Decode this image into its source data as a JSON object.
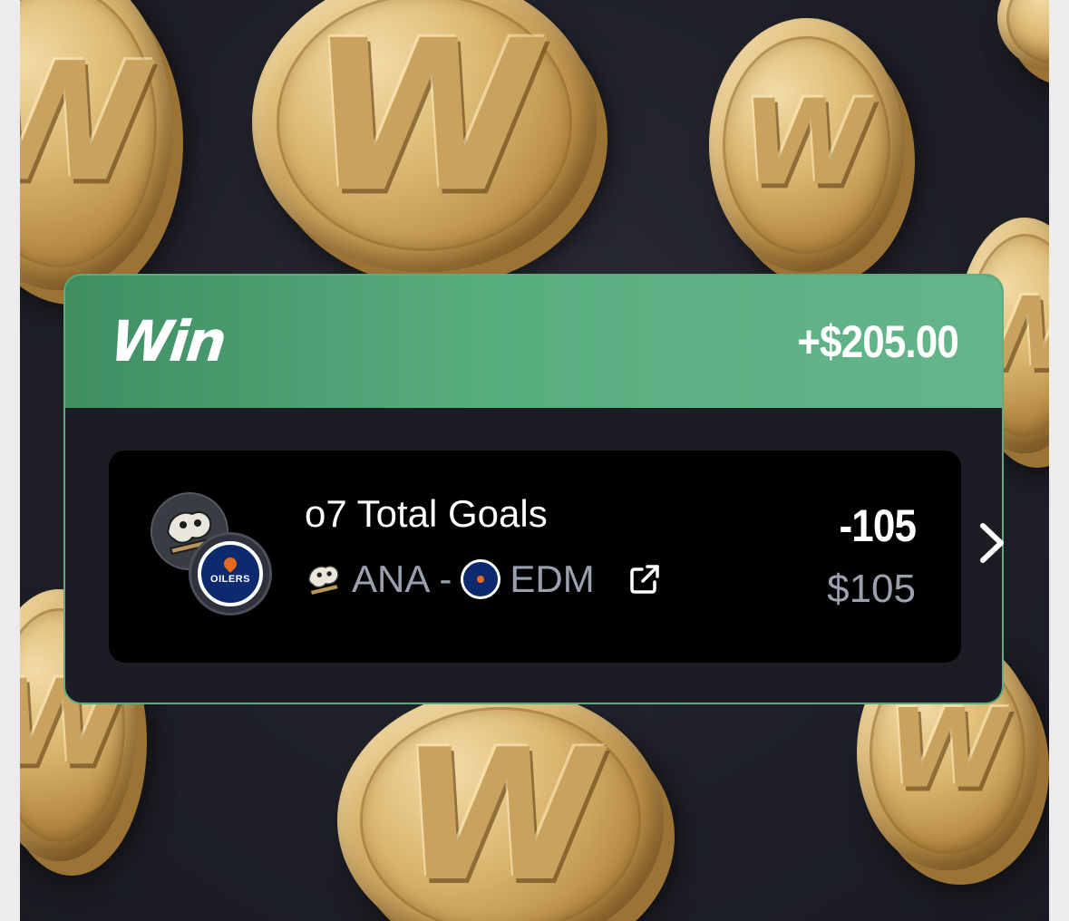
{
  "header": {
    "brand": "Win",
    "payout": "+$205.00"
  },
  "bet": {
    "title": "o7 Total Goals",
    "home_team": "ANA",
    "separator": "-",
    "away_team": "EDM",
    "odds": "-105",
    "stake": "$105"
  },
  "logos": {
    "primary_team": "ducks-logo",
    "secondary_team": "oilers-logo",
    "oilers_wordmark": "OILERS"
  },
  "icons": {
    "external_link": "external-link-icon",
    "next": "chevron-right-icon"
  },
  "colors": {
    "header_green": "#58ad7f",
    "border_green": "#5cae80",
    "card_background": "#1c1d24",
    "row_background": "#000000",
    "muted_text": "#9aa0ae",
    "coin_gold": "#d6b26c"
  }
}
